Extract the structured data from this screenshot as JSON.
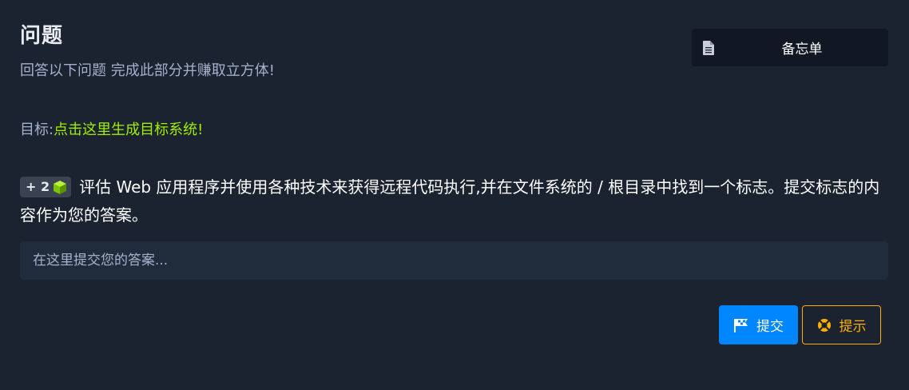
{
  "header": {
    "title": "问题",
    "subtitle": "回答以下问题 完成此部分并赚取立方体!"
  },
  "memo_button": {
    "label": "备忘单",
    "icon": "document-icon"
  },
  "target": {
    "label": "目标:",
    "link_text": "点击这里生成目标系统!"
  },
  "question": {
    "points": "+ 2",
    "points_icon": "cube-icon",
    "text": "评估 Web 应用程序并使用各种技术来获得远程代码执行,并在文件系统的 / 根目录中找到一个标志。提交标志的内容作为您的答案。"
  },
  "answer": {
    "placeholder": "在这里提交您的答案...",
    "value": ""
  },
  "actions": {
    "submit_label": "提交",
    "hint_label": "提示"
  },
  "colors": {
    "background": "#1b2230",
    "accent_green": "#9fef00",
    "submit_blue": "#0086ff",
    "hint_orange": "#ffaf00"
  }
}
